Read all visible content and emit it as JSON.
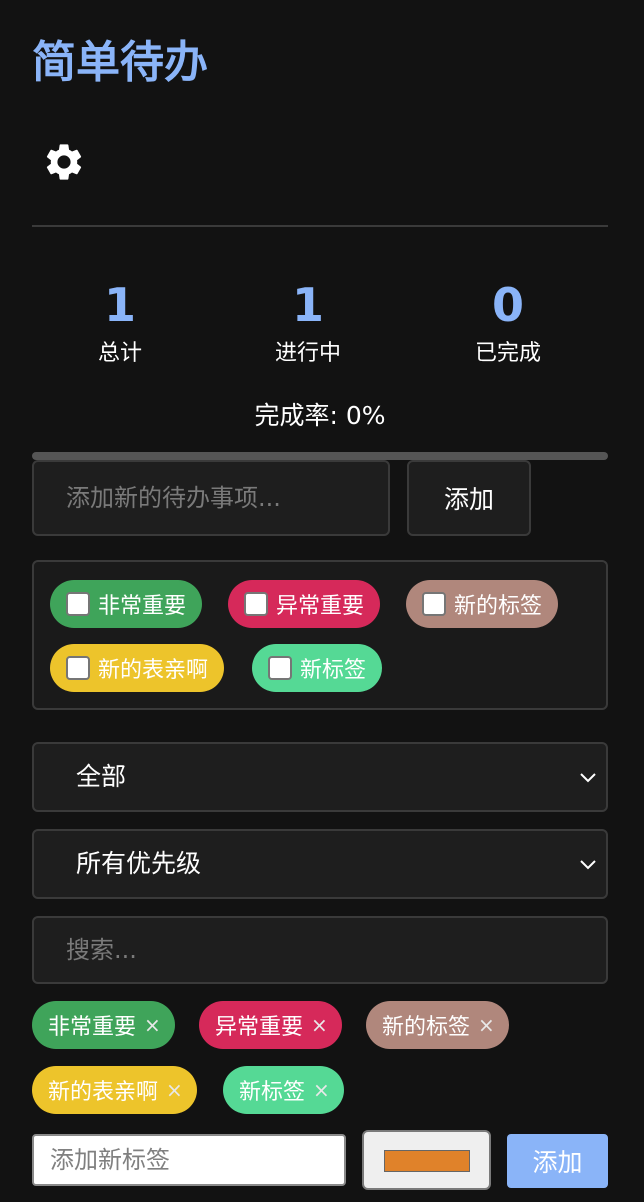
{
  "app": {
    "title": "简单待办"
  },
  "settings": {
    "icon": "gear-icon"
  },
  "stats": {
    "total": {
      "value": "1",
      "label": "总计"
    },
    "in_progress": {
      "value": "1",
      "label": "进行中"
    },
    "done": {
      "value": "0",
      "label": "已完成"
    },
    "completion_rate_text": "完成率: 0%",
    "completion_rate": 0
  },
  "new_todo": {
    "placeholder": "添加新的待办事项...",
    "add_label": "添加"
  },
  "tag_options": [
    {
      "label": "非常重要",
      "color": "#3fa45a",
      "checked": false
    },
    {
      "label": "异常重要",
      "color": "#d6295a",
      "checked": false
    },
    {
      "label": "新的标签",
      "color": "#b0877c",
      "checked": false
    },
    {
      "label": "新的表亲啊",
      "color": "#edc42b",
      "checked": false
    },
    {
      "label": "新标签",
      "color": "#55d995",
      "checked": false
    }
  ],
  "filters": {
    "status": {
      "selected": "全部"
    },
    "priority": {
      "selected": "所有优先级"
    }
  },
  "search": {
    "placeholder": "搜索..."
  },
  "tags": [
    {
      "label": "非常重要",
      "color": "#3fa45a",
      "remove": "×"
    },
    {
      "label": "异常重要",
      "color": "#d6295a",
      "remove": "×"
    },
    {
      "label": "新的标签",
      "color": "#b0877c",
      "remove": "×"
    },
    {
      "label": "新的表亲啊",
      "color": "#edc42b",
      "remove": "×"
    },
    {
      "label": "新标签",
      "color": "#55d995",
      "remove": "×"
    }
  ],
  "new_tag": {
    "placeholder": "添加新标签",
    "color": "#e0822a",
    "add_label": "添加"
  },
  "colors": {
    "accent": "#8ab4f8",
    "background": "#121212"
  }
}
